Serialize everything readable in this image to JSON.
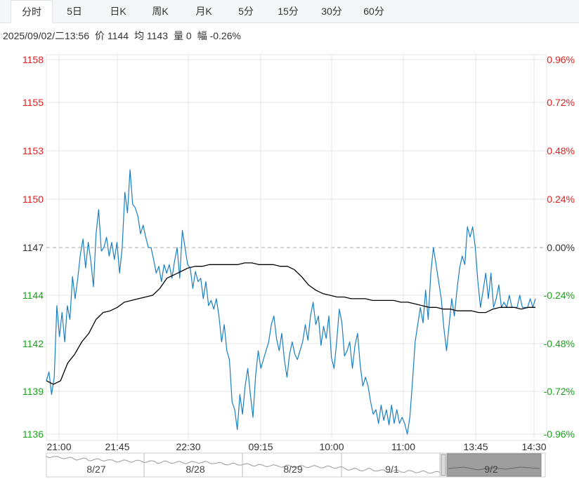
{
  "tabs": [
    {
      "label": "分时",
      "active": true
    },
    {
      "label": "5日",
      "active": false
    },
    {
      "label": "日K",
      "active": false
    },
    {
      "label": "周K",
      "active": false
    },
    {
      "label": "月K",
      "active": false
    },
    {
      "label": "5分",
      "active": false
    },
    {
      "label": "15分",
      "active": false
    },
    {
      "label": "30分",
      "active": false
    },
    {
      "label": "60分",
      "active": false
    }
  ],
  "info": {
    "datetime": "2025/09/02/二13:56",
    "price": "价 1144",
    "avg": "均 1143",
    "volume": "量 0",
    "change": "幅 -0.26%"
  },
  "colors": {
    "up": "#e02020",
    "down": "#1aa31a",
    "neutral": "#333333",
    "price_line": "#1a7fc1",
    "avg_line": "#000000",
    "grid": "#e6e6e6"
  },
  "chart_data": {
    "type": "line",
    "title": "",
    "prev_close": 1147,
    "ylim": [
      1135.9,
      1158.0
    ],
    "x_tick_labels": [
      "21:00",
      "21:45",
      "22:30",
      "09:15",
      "10:00",
      "11:00",
      "13:45",
      "14:30"
    ],
    "y_left_labels": [
      "1158",
      "1155",
      "1153",
      "1150",
      "1147",
      "1144",
      "1142",
      "1139",
      "1136"
    ],
    "y_right_labels": [
      "0.96%",
      "0.72%",
      "0.48%",
      "0.24%",
      "0.00%",
      "-0.24%",
      "-0.48%",
      "-0.72%",
      "-0.96%"
    ],
    "grid": true,
    "series": [
      {
        "kind": "price",
        "x_range_minutes": [
          0,
          345
        ],
        "values": [
          1139.3,
          1139.8,
          1138.5,
          1139.5,
          1143.6,
          1141.8,
          1143.2,
          1141.5,
          1143.6,
          1142.8,
          1145.3,
          1144.0,
          1145.2,
          1146.6,
          1147.5,
          1145.8,
          1147.3,
          1146.2,
          1144.7,
          1147.8,
          1149.2,
          1146.8,
          1147.0,
          1147.6,
          1146.5,
          1147.3,
          1146.3,
          1147.3,
          1145.5,
          1147.0,
          1150.2,
          1149.0,
          1151.5,
          1149.5,
          1149.3,
          1148.8,
          1147.8,
          1148.3,
          1147.6,
          1147.0,
          1147.0,
          1146.3,
          1145.5,
          1145.9,
          1145.0,
          1146.0,
          1145.5,
          1146.0,
          1145.2,
          1146.2,
          1147.0,
          1145.2,
          1148.0,
          1147.0,
          1146.0,
          1145.8,
          1144.6,
          1145.6,
          1145.0,
          1145.2,
          1144.0,
          1145.0,
          1143.6,
          1143.9,
          1143.4,
          1144.0,
          1143.0,
          1141.5,
          1142.5,
          1141.0,
          1140.5,
          1138.0,
          1137.5,
          1136.2,
          1138.5,
          1137.2,
          1139.0,
          1140.0,
          1138.5,
          1137.0,
          1139.6,
          1141.0,
          1140.0,
          1140.5,
          1141.0,
          1141.5,
          1142.5,
          1143.0,
          1141.7,
          1141.0,
          1142.0,
          1140.5,
          1139.5,
          1140.8,
          1141.5,
          1140.8,
          1140.5,
          1141.0,
          1141.5,
          1142.5,
          1141.6,
          1143.0,
          1143.8,
          1142.5,
          1143.0,
          1141.3,
          1142.4,
          1141.7,
          1143.0,
          1140.6,
          1140.0,
          1141.5,
          1143.4,
          1142.6,
          1140.7,
          1141.0,
          1141.5,
          1140.0,
          1141.3,
          1142.0,
          1140.2,
          1139.0,
          1139.5,
          1139.0,
          1138.0,
          1137.2,
          1137.5,
          1136.6,
          1137.8,
          1136.8,
          1137.5,
          1136.5,
          1137.8,
          1136.6,
          1137.5,
          1136.6,
          1137.0,
          1136.6,
          1135.9,
          1137.0,
          1139.3,
          1141.5,
          1142.5,
          1143.5,
          1142.6,
          1144.5,
          1142.8,
          1145.5,
          1147.0,
          1146.0,
          1145.0,
          1144.0,
          1142.3,
          1141.0,
          1142.5,
          1144.0,
          1143.0,
          1144.5,
          1145.8,
          1146.5,
          1146.0,
          1148.2,
          1147.6,
          1148.2,
          1147.0,
          1145.0,
          1143.5,
          1144.5,
          1145.5,
          1144.0,
          1145.5,
          1143.5,
          1144.0,
          1144.8,
          1143.5,
          1143.8,
          1143.5,
          1144.2,
          1143.5,
          1143.5,
          1143.5,
          1144.2,
          1143.5,
          1143.5,
          1143.5,
          1144.0,
          1143.5,
          1144.0
        ]
      },
      {
        "kind": "average",
        "x_range_minutes": [
          0,
          345
        ],
        "values": [
          1139.3,
          1139.1,
          1139.3,
          1140.3,
          1140.8,
          1141.5,
          1142.0,
          1142.8,
          1143.2,
          1143.3,
          1143.5,
          1143.8,
          1143.9,
          1144.0,
          1144.1,
          1144.2,
          1144.6,
          1145.2,
          1145.4,
          1145.6,
          1145.8,
          1145.9,
          1145.9,
          1146.0,
          1146.0,
          1146.0,
          1146.0,
          1146.0,
          1146.1,
          1146.1,
          1146.0,
          1146.0,
          1146.0,
          1145.9,
          1145.9,
          1145.7,
          1145.3,
          1144.8,
          1144.5,
          1144.3,
          1144.2,
          1144.1,
          1144.1,
          1144.0,
          1144.0,
          1144.0,
          1143.9,
          1143.9,
          1143.9,
          1143.9,
          1143.8,
          1143.8,
          1143.7,
          1143.6,
          1143.5,
          1143.5,
          1143.4,
          1143.4,
          1143.3,
          1143.3,
          1143.3,
          1143.2,
          1143.2,
          1143.4,
          1143.5,
          1143.5,
          1143.5,
          1143.4,
          1143.5,
          1143.5
        ]
      }
    ]
  },
  "navigator": {
    "labels": [
      "8/27",
      "8/28",
      "8/29",
      "9/1",
      "9/2"
    ]
  }
}
